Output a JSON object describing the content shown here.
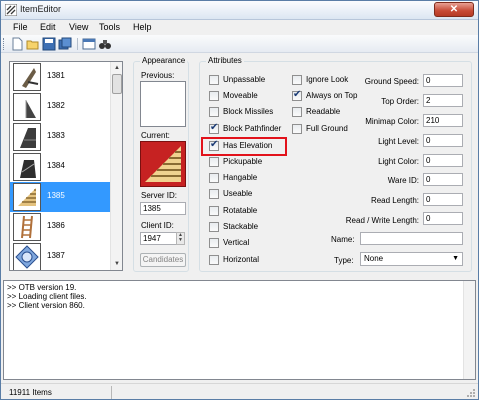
{
  "window": {
    "title": "ItemEditor",
    "close": "✕"
  },
  "menu": [
    "File",
    "Edit",
    "View",
    "Tools",
    "Help"
  ],
  "items": [
    {
      "id": "1381"
    },
    {
      "id": "1382"
    },
    {
      "id": "1383"
    },
    {
      "id": "1384"
    },
    {
      "id": "1385"
    },
    {
      "id": "1386"
    },
    {
      "id": "1387"
    }
  ],
  "appearance": {
    "title": "Appearance",
    "previous_label": "Previous:",
    "current_label": "Current:",
    "server_id_label": "Server ID:",
    "server_id": "1385",
    "client_id_label": "Client ID:",
    "client_id": "1947",
    "candidates_label": "Candidates"
  },
  "attributes": {
    "title": "Attributes",
    "flags": [
      {
        "label": "Unpassable",
        "checked": false
      },
      {
        "label": "Moveable",
        "checked": false
      },
      {
        "label": "Block Missiles",
        "checked": false
      },
      {
        "label": "Block Pathfinder",
        "checked": true
      },
      {
        "label": "Has Elevation",
        "checked": true
      },
      {
        "label": "Pickupable",
        "checked": false
      },
      {
        "label": "Hangable",
        "checked": false
      },
      {
        "label": "Useable",
        "checked": false
      },
      {
        "label": "Rotatable",
        "checked": false
      },
      {
        "label": "Stackable",
        "checked": false
      },
      {
        "label": "Vertical",
        "checked": false
      },
      {
        "label": "Horizontal",
        "checked": false
      }
    ],
    "flags2": [
      {
        "label": "Ignore Look",
        "checked": false
      },
      {
        "label": "Always on Top",
        "checked": true
      },
      {
        "label": "Readable",
        "checked": false
      },
      {
        "label": "Full Ground",
        "checked": false
      }
    ],
    "fields": [
      {
        "label": "Ground Speed:",
        "value": "0"
      },
      {
        "label": "Top Order:",
        "value": "2"
      },
      {
        "label": "Minimap Color:",
        "value": "210"
      },
      {
        "label": "Light Level:",
        "value": "0"
      },
      {
        "label": "Light Color:",
        "value": "0"
      },
      {
        "label": "Ware ID:",
        "value": "0"
      },
      {
        "label": "Read Length:",
        "value": "0"
      },
      {
        "label": "Read / Write Length:",
        "value": "0"
      }
    ],
    "name_label": "Name:",
    "name_value": "",
    "type_label": "Type:",
    "type_value": "None"
  },
  "log": [
    ">> OTB version 19.",
    ">> Loading client files.",
    ">> Client version 860."
  ],
  "status": {
    "items": "11911 Items"
  },
  "colors": {
    "selection": "#3399ff",
    "highlight": "#e2121b",
    "current_bg": "#c62222"
  }
}
